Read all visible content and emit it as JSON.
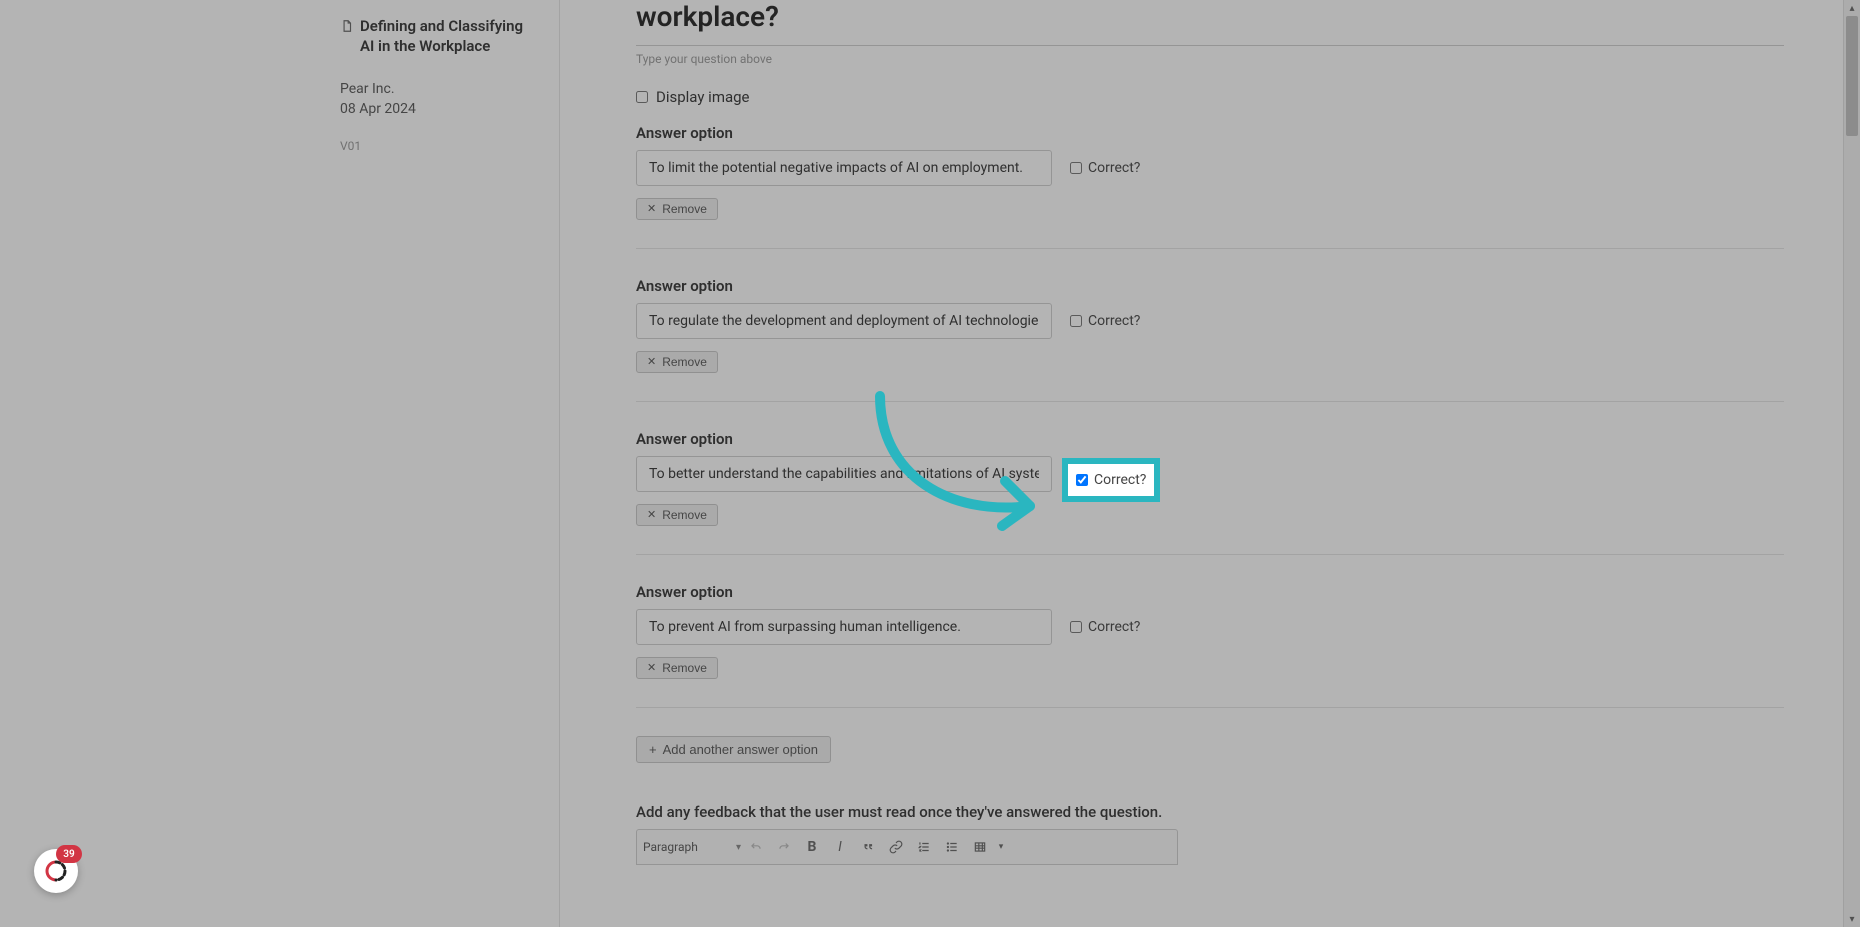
{
  "sidebar": {
    "doc_title": "Defining and Classifying AI in the Workplace",
    "org": "Pear Inc.",
    "date": "08 Apr 2024",
    "version": "V01"
  },
  "editor": {
    "question_visible_tail": "workplace?",
    "helper_text": "Type your question above",
    "display_image_label": "Display image",
    "display_image_checked": false,
    "answer_label": "Answer option",
    "correct_label": "Correct?",
    "remove_label": "Remove",
    "options": [
      {
        "value": "To limit the potential negative impacts of AI on employment.",
        "correct": false
      },
      {
        "value": "To regulate the development and deployment of AI technologies.",
        "correct": false
      },
      {
        "value": "To better understand the capabilities and limitations of AI systems.",
        "correct": true
      },
      {
        "value": "To prevent AI from surpassing human intelligence.",
        "correct": false
      }
    ],
    "add_option_label": "Add another answer option",
    "feedback_label": "Add any feedback that the user must read once they've answered the question.",
    "rte": {
      "paragraph_label": "Paragraph"
    }
  },
  "help": {
    "badge_count": "39"
  },
  "highlight": {
    "target_option_index": 2
  },
  "colors": {
    "highlight": "#2ab6c0",
    "overlay": "rgba(40,40,40,0.35)",
    "badge": "#d23544"
  }
}
